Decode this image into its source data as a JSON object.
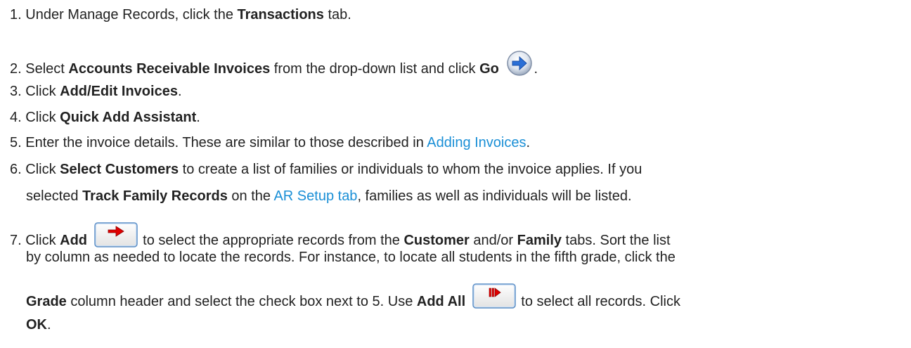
{
  "steps": [
    {
      "num": "1.",
      "t1": "Under Manage Records, click the ",
      "b1": "Transactions",
      "t2": " tab."
    },
    {
      "num": "2.",
      "t1": "Select ",
      "b1": "Accounts Receivable Invoices",
      "t2": " from the drop-down list and click ",
      "b2": "Go",
      "t3": "."
    },
    {
      "num": "3.",
      "t1": "Click ",
      "b1": "Add/Edit Invoices",
      "t2": "."
    },
    {
      "num": "4.",
      "t1": "Click ",
      "b1": "Quick Add Assistant",
      "t2": "."
    },
    {
      "num": "5.",
      "t1": "Enter the invoice details. These are similar to those described in ",
      "link1": "Adding Invoices",
      "t2": "."
    },
    {
      "num": "6.",
      "t1": "Click ",
      "b1": "Select Customers",
      "t2": " to create a list of families or individuals to whom the invoice applies. If you",
      "l2_t1": "selected ",
      "l2_b1": "Track Family Records",
      "l2_t2": " on the ",
      "l2_link1": "AR Setup tab",
      "l2_t3": ", families as well as individuals will be listed."
    },
    {
      "num": "7.",
      "t1": "Click ",
      "b1": "Add",
      "t2": " to select the appropriate records from the ",
      "b2": "Customer",
      "t3": " and/or ",
      "b3": "Family",
      "t4": " tabs. Sort the list",
      "l2": "by column as needed to locate the records. For instance, to locate all students in the fifth grade, click the",
      "l3_b1": "Grade",
      "l3_t1": " column header and select the check box next to 5. Use ",
      "l3_b2": "Add All",
      "l3_t2": " to select all records. Click",
      "l4_b1": "OK",
      "l4_t1": "."
    }
  ],
  "icons": {
    "go": "go-arrow-icon",
    "add": "add-arrow-icon",
    "add_all": "add-all-arrow-icon"
  },
  "colors": {
    "text": "#222222",
    "link": "#1a8fd6",
    "arrow_red": "#e00000",
    "go_blue": "#2a6fd6"
  }
}
